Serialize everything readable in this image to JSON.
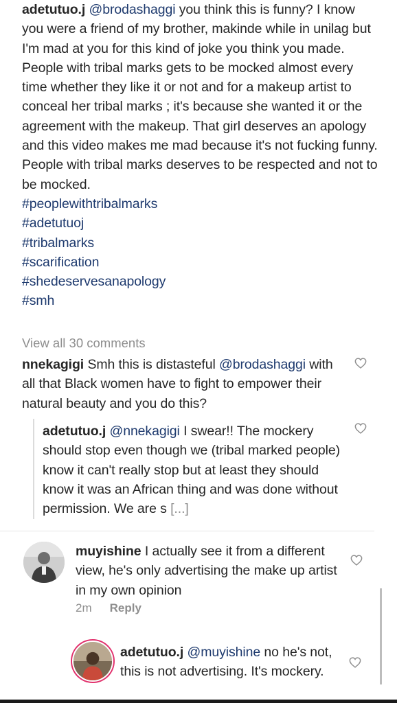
{
  "post": {
    "username": "adetutuo.j",
    "mention": "@brodashaggi",
    "caption_text": " you think this is funny? I know you were a friend of my brother, makinde while in unilag but I'm mad at you for this kind of joke you think you made. People with tribal marks gets to be mocked almost every time  whether they like it or not and for a makeup artist to conceal her tribal marks ; it's because she wanted it or the agreement with the makeup. That girl deserves an apology and this video makes me mad because it's not fucking funny. People with tribal marks deserves to be respected and not to be mocked.",
    "hashtags": [
      "#peoplewithtribalmarks",
      "#adetutuoj",
      "#tribalmarks",
      "#scarification",
      "#shedeservesanapology",
      "#smh"
    ]
  },
  "view_all": "View all 30 comments",
  "comments": [
    {
      "username": "nnekagigi",
      "text_before": " Smh this is distasteful ",
      "mention": "@brodashaggi",
      "text_after": " with all that Black women have to fight to empower their natural beauty and you do this?"
    },
    {
      "username": "adetutuo.j",
      "mention": "@nnekagigi",
      "text": " I swear!! The mockery should stop even though we (tribal marked people) know it can't really stop but at least they should know it was an African thing and was done without permission. We are s",
      "more": " [...]"
    },
    {
      "username": "muyishine",
      "text": " I actually see it from a different view, he's only advertising the make up artist in my own opinion",
      "time": "2m",
      "reply_label": "Reply"
    },
    {
      "username": "adetutuo.j",
      "mention": "@muyishine",
      "text": " no he's not, this is not advertising. It's mockery."
    }
  ],
  "icons": {
    "heart": "heart-outline-icon",
    "avatar_muyishine": "avatar-photo",
    "avatar_adetutuo": "avatar-photo"
  },
  "colors": {
    "link": "#1e3a6e",
    "muted": "#8e8e8e",
    "text": "#262626"
  }
}
